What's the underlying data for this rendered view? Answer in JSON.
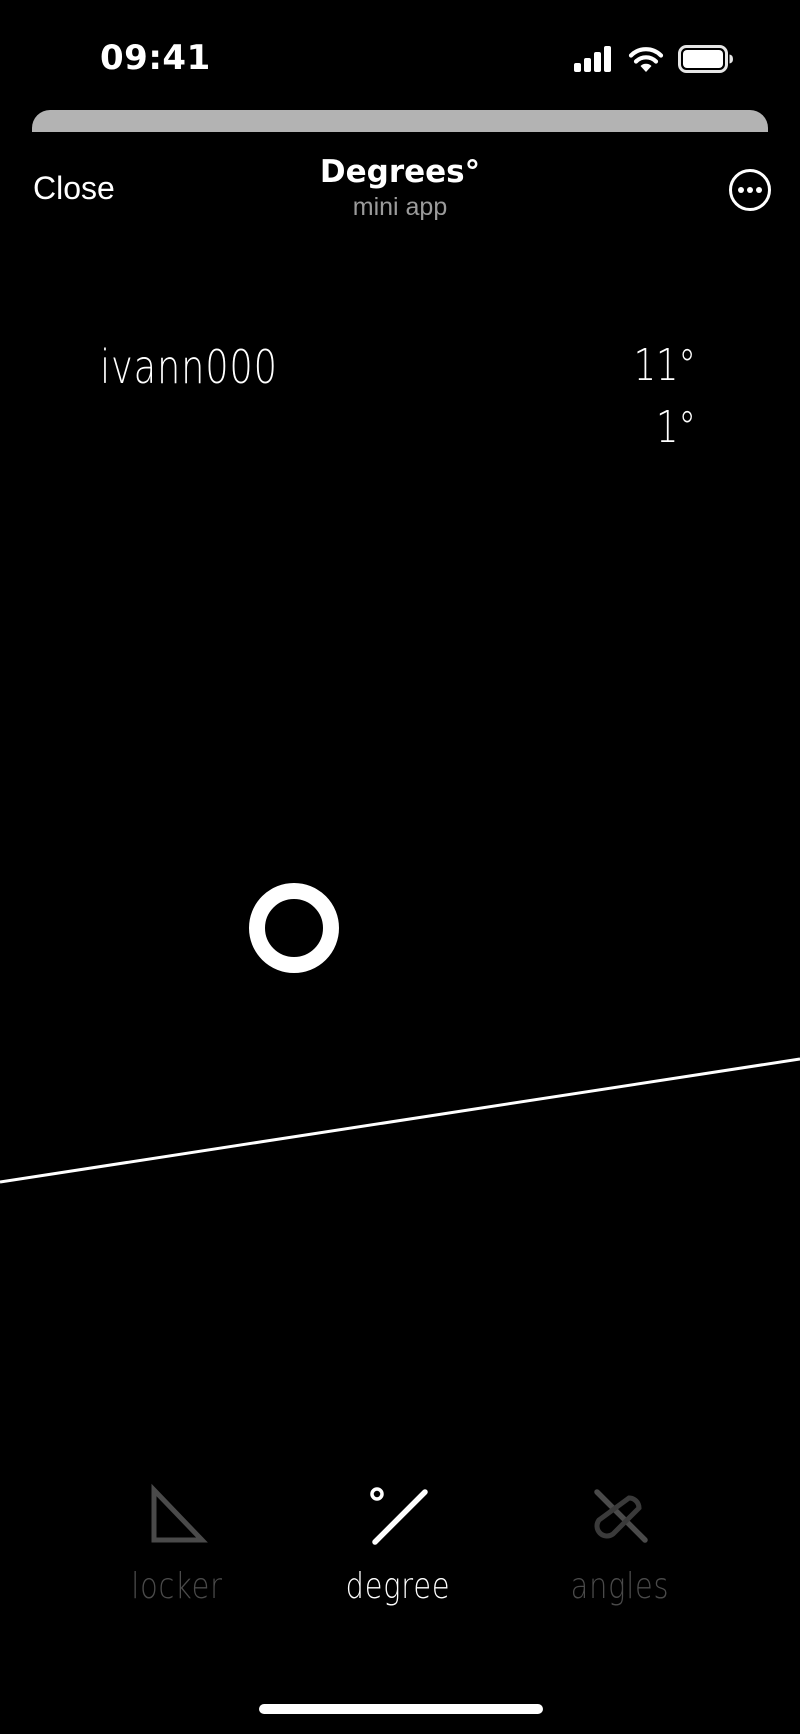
{
  "status_bar": {
    "time": "09:41",
    "icons": [
      "cellular-signal-icon",
      "wifi-icon",
      "battery-icon"
    ]
  },
  "header": {
    "close_label": "Close",
    "title": "Degrees°",
    "subtitle": "mini app",
    "more_icon": "more-horizontal-icon"
  },
  "readout": {
    "username": "ivann000",
    "primary_angle": "11°",
    "secondary_angle": "1°"
  },
  "tabs": [
    {
      "label": "locker",
      "icon": "triangle-ruler-icon",
      "active": false
    },
    {
      "label": "degree",
      "icon": "degree-slash-icon",
      "active": true
    },
    {
      "label": "angles",
      "icon": "crossed-angles-icon",
      "active": false
    }
  ],
  "colors": {
    "background": "#000000",
    "foreground": "#ffffff",
    "inactive_tab": "#4a4a4a",
    "subtitle": "#9b9b9b",
    "sheet_handle": "#b3b3b3"
  }
}
